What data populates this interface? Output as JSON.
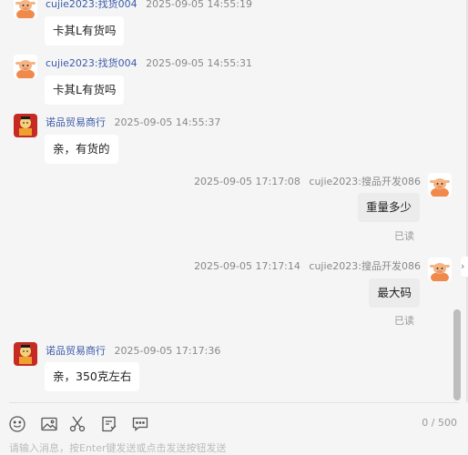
{
  "messages": [
    {
      "side": "left",
      "avatar": "cow-avatar-icon",
      "sender": "cujie2023:找货004",
      "time": "2025-09-05 14:55:19",
      "text": "卡其L有货吗"
    },
    {
      "side": "left",
      "avatar": "cow-avatar-icon",
      "sender": "cujie2023:找货004",
      "time": "2025-09-05 14:55:31",
      "text": "卡其L有货吗"
    },
    {
      "side": "left",
      "avatar": "shop-avatar-icon",
      "sender": "诺品贸易商行",
      "time": "2025-09-05 14:55:37",
      "text": "亲，有货的"
    },
    {
      "side": "right",
      "avatar": "cow-avatar-icon",
      "sender": "cujie2023:搜品开发086",
      "time": "2025-09-05 17:17:08",
      "text": "重量多少",
      "status": "已读"
    },
    {
      "side": "right",
      "avatar": "cow-avatar-icon",
      "sender": "cujie2023:搜品开发086",
      "time": "2025-09-05 17:17:14",
      "text": "最大码",
      "status": "已读"
    },
    {
      "side": "left",
      "avatar": "shop-avatar-icon",
      "sender": "诺品贸易商行",
      "time": "2025-09-05 17:17:36",
      "text": "亲，350克左右"
    }
  ],
  "toolbar": {
    "icons": [
      "emoji-icon",
      "image-icon",
      "scissors-icon",
      "quick-reply-icon",
      "chat-icon"
    ],
    "counter": "0 / 500",
    "input_hint": "请输入消息，按Enter键发送或点击发送按钮发送"
  },
  "colors": {
    "background": "#f5f5f6",
    "bubble_left": "#ffffff",
    "bubble_right": "#ececec",
    "sender_name": "#3a5aa8"
  }
}
